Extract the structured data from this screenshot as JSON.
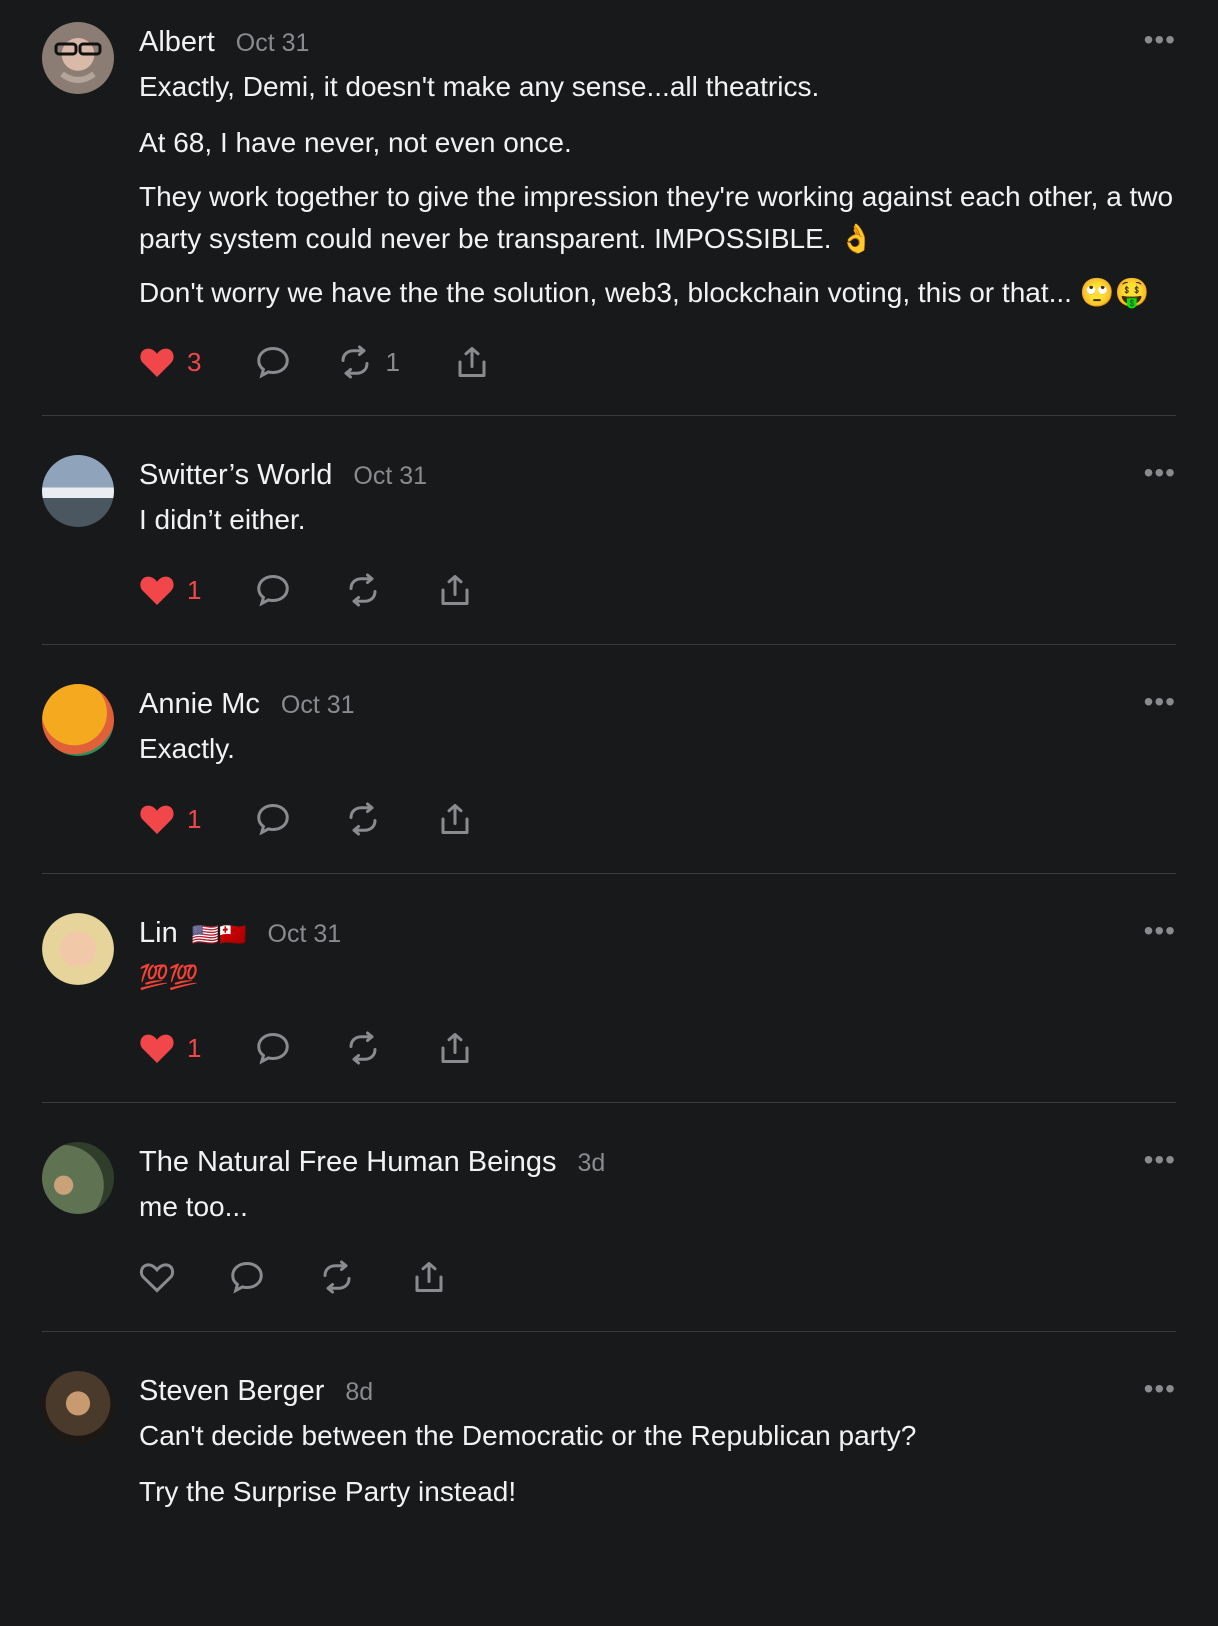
{
  "comments": [
    {
      "author": "Albert",
      "date": "Oct 31",
      "paragraphs": [
        "Exactly, Demi, it doesn't make any sense...all theatrics.",
        "At 68, I have never, not even once.",
        "They work together to give the impression they're working against each other, a two party system could never be transparent. IMPOSSIBLE. 👌",
        "Don't worry we have the the solution, web3, blockchain voting, this or that... 🙄🤑"
      ],
      "likes": "3",
      "reposts": "1",
      "liked": true,
      "avatar_color": "#8c7d74"
    },
    {
      "author": "Switter’s World",
      "date": "Oct 31",
      "paragraphs": [
        "I didn’t either."
      ],
      "likes": "1",
      "liked": true,
      "avatar_color": "#6d7f93"
    },
    {
      "author": "Annie Mc",
      "date": "Oct 31",
      "paragraphs": [
        "Exactly."
      ],
      "likes": "1",
      "liked": true,
      "avatar_color": "#f4a91f"
    },
    {
      "author": "Lin",
      "flags": "🇺🇸🇹🇴",
      "date": "Oct 31",
      "paragraphs": [
        "💯💯"
      ],
      "likes": "1",
      "liked": true,
      "avatar_color": "#e7d49a"
    },
    {
      "author": "The Natural Free Human Beings",
      "date": "3d",
      "paragraphs": [
        "me too..."
      ],
      "liked": false,
      "avatar_color": "#5f7352"
    },
    {
      "author": "Steven Berger",
      "date": "8d",
      "paragraphs": [
        "Can't decide between the Democratic or the Republican party?",
        "Try the Surprise Party instead!"
      ],
      "liked": false,
      "avatar_color": "#4a3a2c"
    }
  ],
  "colors": {
    "background": "#18191b",
    "like_red": "#f1474b",
    "muted": "#8a8b8f"
  },
  "icons": [
    "heart-icon",
    "comment-icon",
    "repost-icon",
    "share-icon",
    "more-icon"
  ]
}
